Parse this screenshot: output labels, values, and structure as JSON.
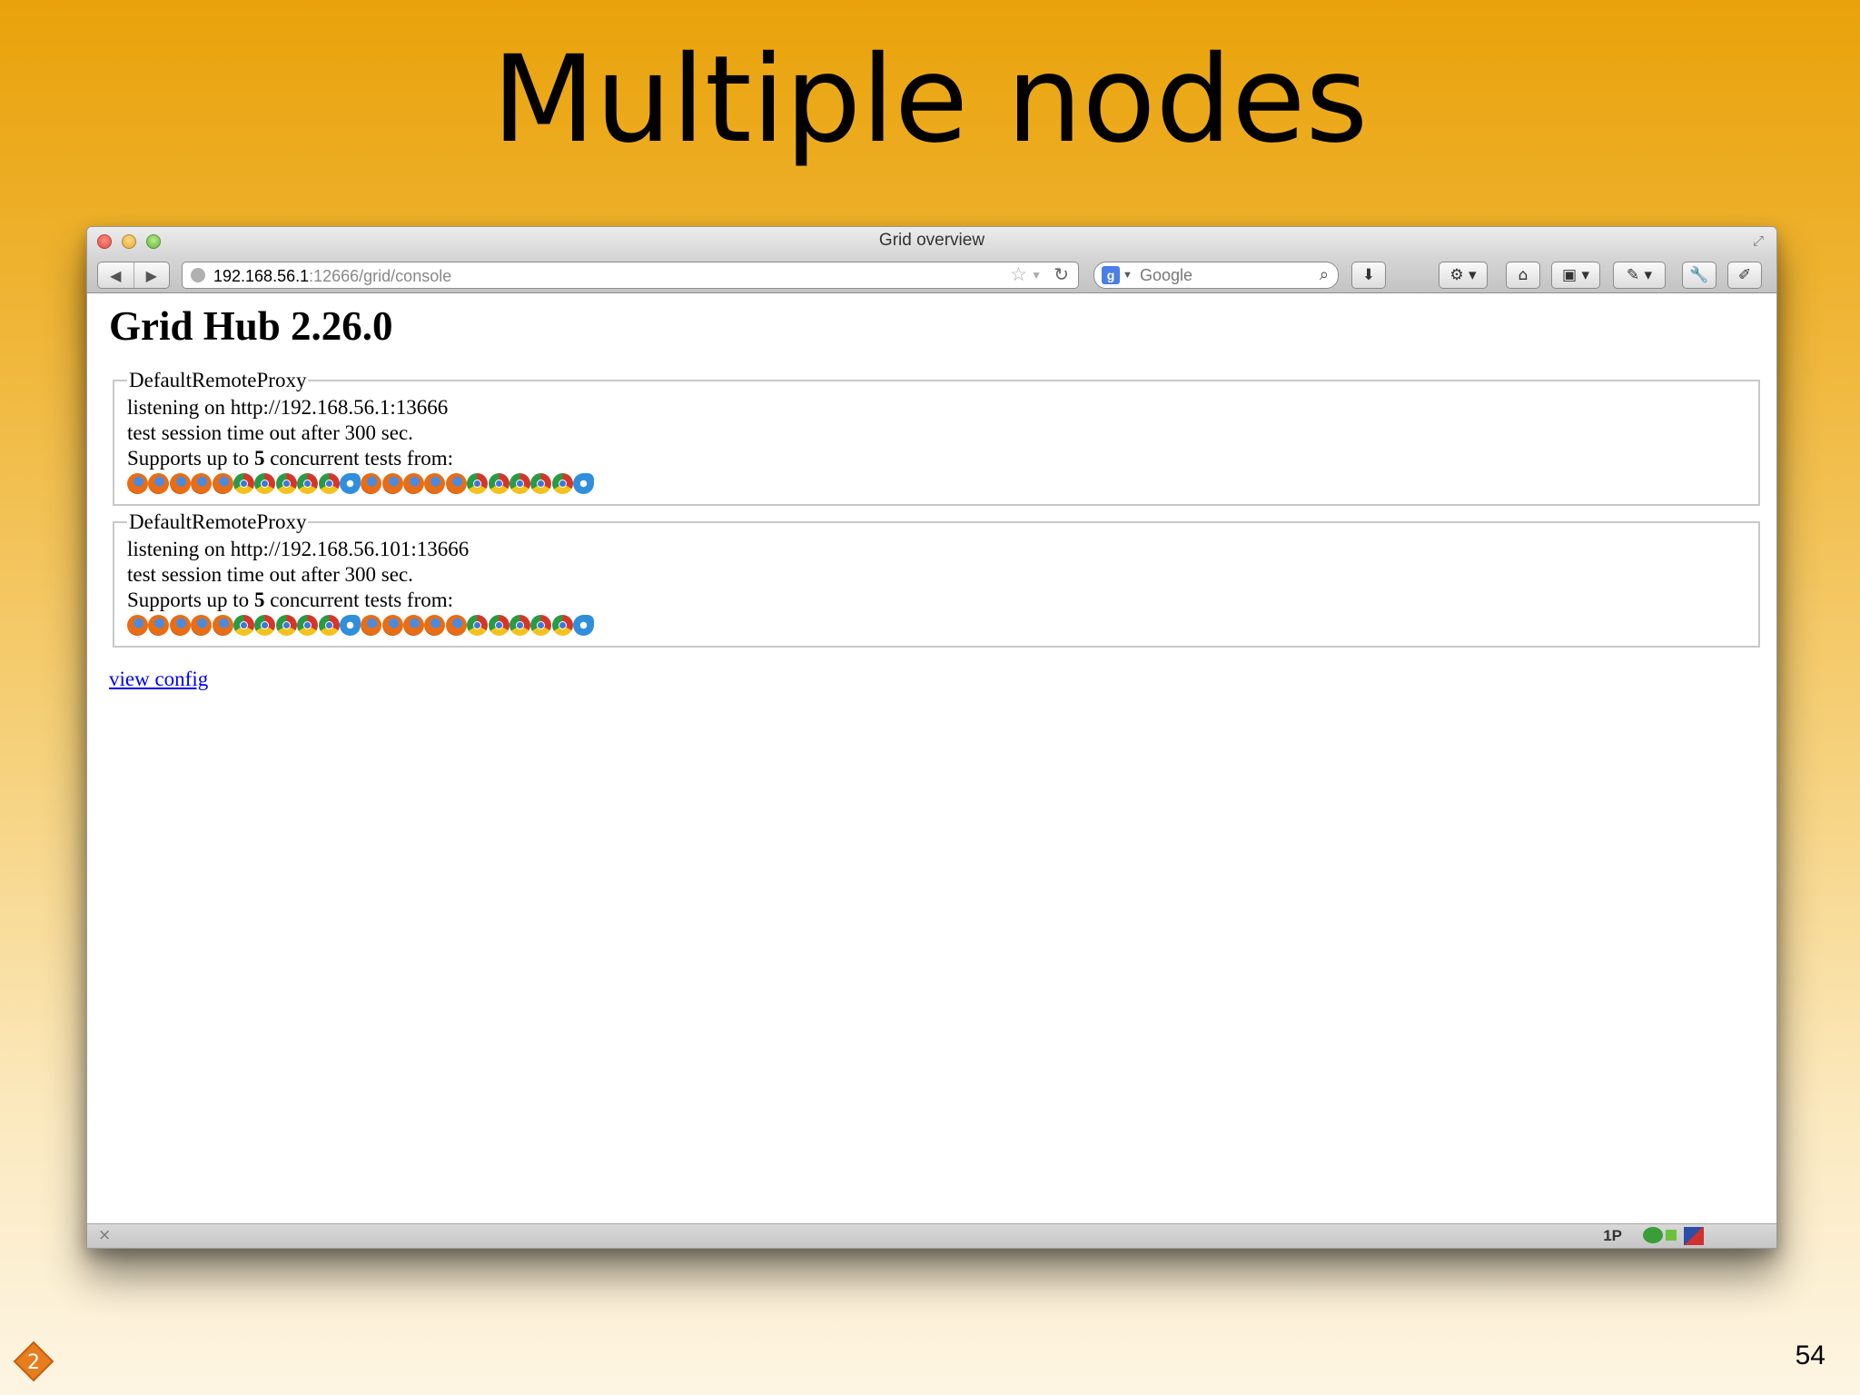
{
  "slide": {
    "title": "Multiple nodes",
    "page_number": "54",
    "logo_label": "2"
  },
  "window": {
    "title": "Grid overview"
  },
  "toolbar": {
    "back_icon": "back-arrow-icon",
    "forward_icon": "forward-arrow-icon",
    "url_host": "192.168.56.1",
    "url_rest": ":12666/grid/console",
    "search_placeholder": "Google"
  },
  "page": {
    "title": "Grid Hub 2.26.0",
    "proxies": [
      {
        "legend": "DefaultRemoteProxy",
        "listening": "listening on http://192.168.56.1:13666",
        "timeout": "test session time out after 300 sec.",
        "supports_prefix": "Supports up to ",
        "concurrent": "5",
        "supports_suffix": " concurrent tests from:"
      },
      {
        "legend": "DefaultRemoteProxy",
        "listening": "listening on http://192.168.56.101:13666",
        "timeout": "test session time out after 300 sec.",
        "supports_prefix": "Supports up to ",
        "concurrent": "5",
        "supports_suffix": " concurrent tests from:"
      }
    ],
    "browser_icon_sequence": [
      "firefox",
      "firefox",
      "firefox",
      "firefox",
      "firefox",
      "chrome",
      "chrome",
      "chrome",
      "chrome",
      "chrome",
      "ie",
      "firefox",
      "firefox",
      "firefox",
      "firefox",
      "firefox",
      "chrome",
      "chrome",
      "chrome",
      "chrome",
      "chrome",
      "ie"
    ],
    "view_config": "view config"
  },
  "statusbar": {
    "onepassword_label": "1P"
  }
}
